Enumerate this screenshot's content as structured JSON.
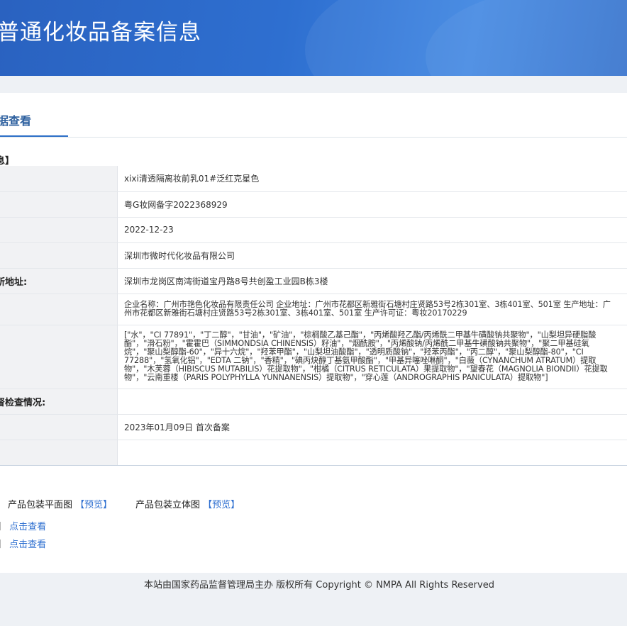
{
  "header": {
    "title": "普通化妆品备案信息"
  },
  "tab": {
    "label": "据查看"
  },
  "section": {
    "title": "息】"
  },
  "table": {
    "rows": [
      {
        "label": ":",
        "value": "xixi清透隔离妆前乳01#泛红克星色"
      },
      {
        "label": ":",
        "value": "粤G妆网备字2022368929"
      },
      {
        "label": ":",
        "value": "2022-12-23"
      },
      {
        "label": "",
        "value": "深圳市微时代化妆品有限公司"
      },
      {
        "label": "所地址:",
        "value": "深圳市龙岗区南湾街道宝丹路8号共创盈工业园B栋3楼"
      },
      {
        "label": ":",
        "lines": [
          "企业名称：广州市艳色化妆品有限责任公司 企业地址：广州市花都区新雅街石塘村庄贤路53号2栋301室、3栋401室、501室 生产地址：广",
          "州市花都区新雅街石塘村庄贤路53号2栋301室、3栋401室、501室 生产许可证：粤妆20170229"
        ]
      },
      {
        "label": "",
        "lines": [
          "[\"水\"，\"CI 77891\"，\"丁二醇\"，\"甘油\"，\"矿油\"，\"棕榈酸乙基己酯\"，\"丙烯酸羟乙酯/丙烯酰二甲基牛磺酸钠共聚物\"，\"山梨坦异硬脂酸",
          "酯\"，\"滑石粉\"，\"霍霍巴（SIMMONDSIA CHINENSIS）籽油\"，\"烟酰胺\"，\"丙烯酸钠/丙烯酰二甲基牛磺酸钠共聚物\"，\"聚二甲基硅氧",
          "烷\"，\"聚山梨醇酯-60\"，\"异十六烷\"，\"羟苯甲酯\"，\"山梨坦油酸酯\"，\"透明质酸钠\"，\"羟苯丙酯\"，\"丙二醇\"，\"聚山梨醇酯-80\"，\"CI",
          "77288\"，\"氢氧化铝\"，\"EDTA 二钠\"，\"香精\"，\"碘丙炔醇丁基氨甲酸酯\"，\"甲基异噻唑啉酮\"，\"白薇（CYNANCHUM ATRATUM）提取",
          "物\"，\"木芙蓉（HIBISCUS MUTABILIS）花提取物\"，\"柑橘（CITRUS RETICULATA）果提取物\"，\"望春花（MAGNOLIA BIONDII）花提取",
          "物\"，\"云南重楼（PARIS POLYPHYLLA YUNNANENSIS）提取物\"，\"穿心莲（ANDROGRAPHIS PANICULATA）提取物\"]"
        ]
      },
      {
        "label": "督检查情况:",
        "value": ""
      },
      {
        "label": ":",
        "value": "2023年01月09日 首次备案"
      },
      {
        "label": "",
        "value": ""
      }
    ]
  },
  "attachments": {
    "title": "】",
    "flat_label": "产品包装平面图",
    "flat_link": "【预览】",
    "three_d_label": "产品包装立体图",
    "three_d_link": "【预览】"
  },
  "misc": [
    {
      "prefix": "】",
      "link": "点击查看"
    },
    {
      "prefix": "】",
      "link": "点击查看"
    }
  ],
  "footer": {
    "text": "本站由国家药品监督管理局主办 版权所有 Copyright © NMPA All Rights Reserved"
  }
}
